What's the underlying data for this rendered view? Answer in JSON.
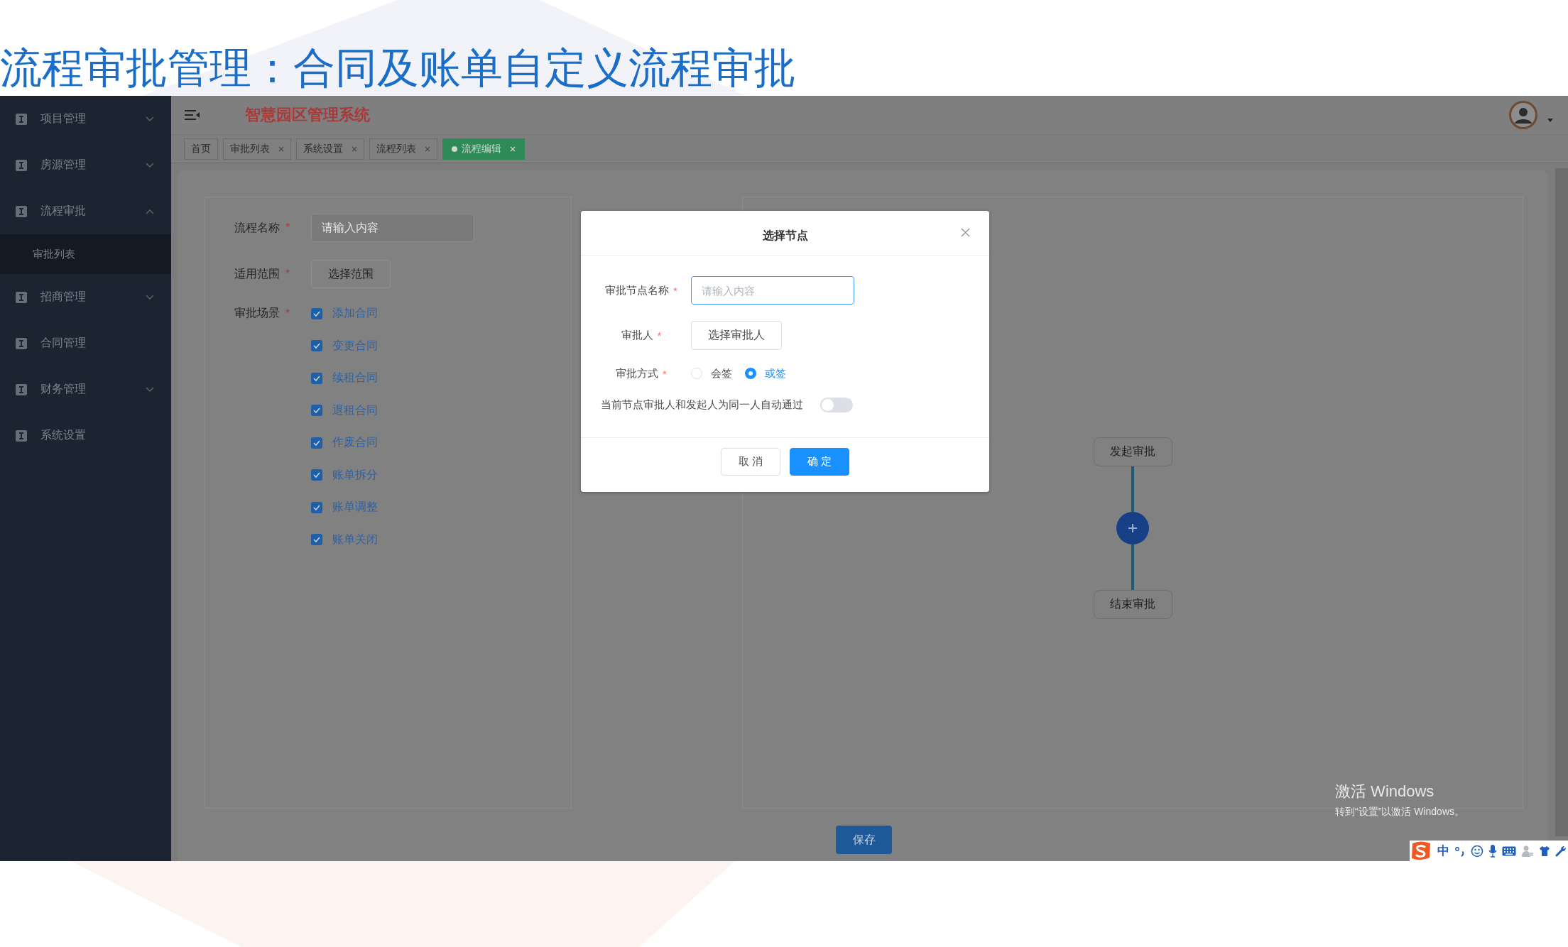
{
  "slide_title": "流程审批管理：合同及账单自定义流程审批",
  "sidebar": {
    "items": [
      {
        "label": "项目管理",
        "kind": "submenu",
        "expanded": false
      },
      {
        "label": "房源管理",
        "kind": "submenu",
        "expanded": false
      },
      {
        "label": "流程审批",
        "kind": "submenu",
        "expanded": true,
        "children": [
          {
            "label": "审批列表"
          }
        ]
      },
      {
        "label": "招商管理",
        "kind": "submenu",
        "expanded": false
      },
      {
        "label": "合同管理",
        "kind": "link"
      },
      {
        "label": "财务管理",
        "kind": "submenu",
        "expanded": false
      },
      {
        "label": "系统设置",
        "kind": "link"
      }
    ]
  },
  "header": {
    "app_title": "智慧园区管理系统"
  },
  "tabs": [
    {
      "label": "首页",
      "selected": false,
      "closable": false
    },
    {
      "label": "审批列表",
      "selected": false,
      "closable": true
    },
    {
      "label": "系统设置",
      "selected": false,
      "closable": true
    },
    {
      "label": "流程列表",
      "selected": false,
      "closable": true
    },
    {
      "label": "流程编辑",
      "selected": true,
      "closable": true
    }
  ],
  "form": {
    "fields": [
      {
        "kind": "input",
        "label": "流程名称",
        "required_mark": "*",
        "placeholder": "请输入内容"
      },
      {
        "kind": "button",
        "label": "适用范围",
        "required_mark": "*",
        "button": "选择范围"
      },
      {
        "kind": "checkboxes",
        "label": "审批场景",
        "required_mark": "*",
        "options": [
          {
            "label": "添加合同",
            "checked": true
          },
          {
            "label": "变更合同",
            "checked": true
          },
          {
            "label": "续租合同",
            "checked": true
          },
          {
            "label": "退租合同",
            "checked": true
          },
          {
            "label": "作废合同",
            "checked": true
          },
          {
            "label": "账单拆分",
            "checked": true
          },
          {
            "label": "账单调整",
            "checked": true
          },
          {
            "label": "账单关闭",
            "checked": true
          }
        ]
      }
    ]
  },
  "flow": {
    "nodes": [
      {
        "kind": "node",
        "label": "发起审批"
      },
      {
        "kind": "add"
      },
      {
        "kind": "node",
        "label": "结束审批"
      }
    ]
  },
  "save_button": "保存",
  "dialog": {
    "title": "选择节点",
    "fields": [
      {
        "kind": "input",
        "label": "审批节点名称",
        "required_mark": "*",
        "placeholder": "请输入内容",
        "focused": true
      },
      {
        "kind": "button",
        "label": "审批人",
        "required_mark": "*",
        "button": "选择审批人"
      },
      {
        "kind": "radio",
        "label": "审批方式",
        "required_mark": "*",
        "options": [
          {
            "label": "会签",
            "selected": false
          },
          {
            "label": "或签",
            "selected": true
          }
        ]
      },
      {
        "kind": "switch",
        "label": "当前节点审批人和发起人为同一人自动通过",
        "on": false
      }
    ],
    "buttons": [
      {
        "kind": "default",
        "label": "取 消"
      },
      {
        "kind": "primary",
        "label": "确 定"
      }
    ]
  },
  "activation_notice": {
    "title": "激活 Windows",
    "subtitle": "转到“设置”以激活 Windows。"
  },
  "ime_toolbar": {
    "mode": "中"
  }
}
